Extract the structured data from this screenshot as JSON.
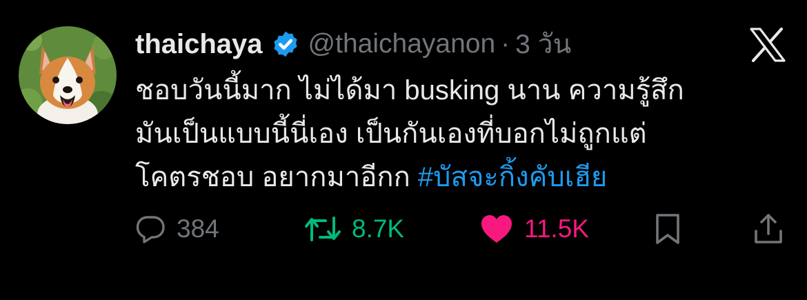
{
  "tweet": {
    "author": {
      "display_name": "thaichaya",
      "handle": "@thaichayanon",
      "verified": true,
      "avatar": "corgi-photo"
    },
    "separator": "·",
    "time": "3 วัน",
    "platform_icon": "x-logo-icon",
    "text_lines": [
      "ชอบวันนี้มาก ไม่ได้มา busking นาน ความรู้สึก",
      "มันเป็นแบบนี้นี่เอง เป็นกันเองที่บอกไม่ถูกแต่",
      "โคตรชอบ อยากมาอีกก "
    ],
    "hashtag": "#บัสจะกิ้งคับเฮีย",
    "actions": {
      "reply": {
        "icon": "reply-icon",
        "count": "384"
      },
      "retweet": {
        "icon": "retweet-icon",
        "count": "8.7K"
      },
      "like": {
        "icon": "heart-icon",
        "count": "11.5K",
        "liked": true
      },
      "bookmark": {
        "icon": "bookmark-icon"
      },
      "share": {
        "icon": "share-icon"
      }
    }
  },
  "colors": {
    "background": "#000000",
    "text": "#e7e9ea",
    "secondary": "#71767b",
    "link": "#1d9bf0",
    "retweet": "#00ba7c",
    "like": "#f91880"
  }
}
